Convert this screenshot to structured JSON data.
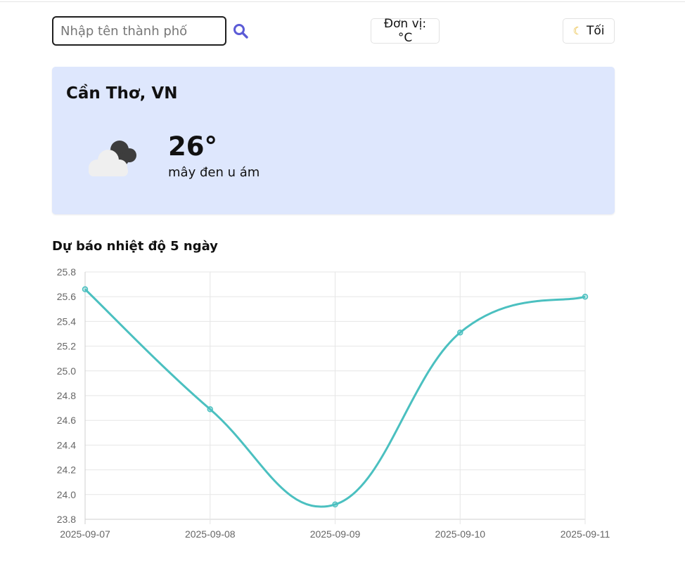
{
  "search": {
    "placeholder": "Nhập tên thành phố"
  },
  "header": {
    "unit_label": "Đơn vị: °C",
    "theme_label": "Tối",
    "theme_icon": "moon-icon"
  },
  "current": {
    "city": "Cần Thơ, VN",
    "temperature": "26°",
    "description": "mây đen u ám",
    "icon": "cloud-icon"
  },
  "forecast": {
    "title": "Dự báo nhiệt độ 5 ngày"
  },
  "colors": {
    "accent": "#5b5bd6",
    "line": "#4bc0c0",
    "card_bg": "#dee7fd"
  },
  "chart_data": {
    "type": "line",
    "categories": [
      "2025-09-07",
      "2025-09-08",
      "2025-09-09",
      "2025-09-10",
      "2025-09-11"
    ],
    "values": [
      25.66,
      24.69,
      23.92,
      25.31,
      25.6
    ],
    "ylim": [
      23.8,
      25.8
    ],
    "yticks": [
      "25.8",
      "25.6",
      "25.4",
      "25.2",
      "25.0",
      "24.8",
      "24.6",
      "24.4",
      "24.2",
      "24.0",
      "23.8"
    ],
    "grid": true,
    "legend": "none"
  }
}
